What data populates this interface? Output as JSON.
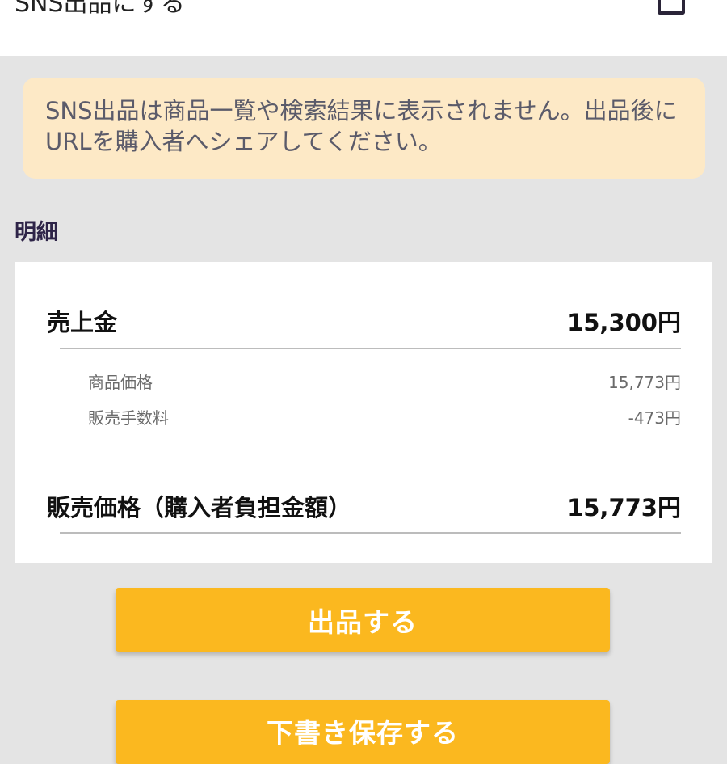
{
  "sns": {
    "label": "SNS出品にする",
    "checked": false
  },
  "notice": {
    "text": "SNS出品は商品一覧や検索結果に表示されません。出品後にURLを購入者へシェアしてください。"
  },
  "breakdown": {
    "title": "明細",
    "sales_amount": {
      "label": "売上金",
      "value": "15,300円"
    },
    "item_price": {
      "label": "商品価格",
      "value": "15,773円"
    },
    "fee": {
      "label": "販売手数料",
      "value": "-473円"
    },
    "selling_price": {
      "label": "販売価格（購入者負担金額）",
      "value": "15,773円"
    }
  },
  "actions": {
    "list_label": "出品する",
    "draft_label": "下書き保存する"
  },
  "colors": {
    "accent": "#fbb81f",
    "notice_bg": "#fde9c6",
    "page_bg": "#e4e4e4"
  }
}
